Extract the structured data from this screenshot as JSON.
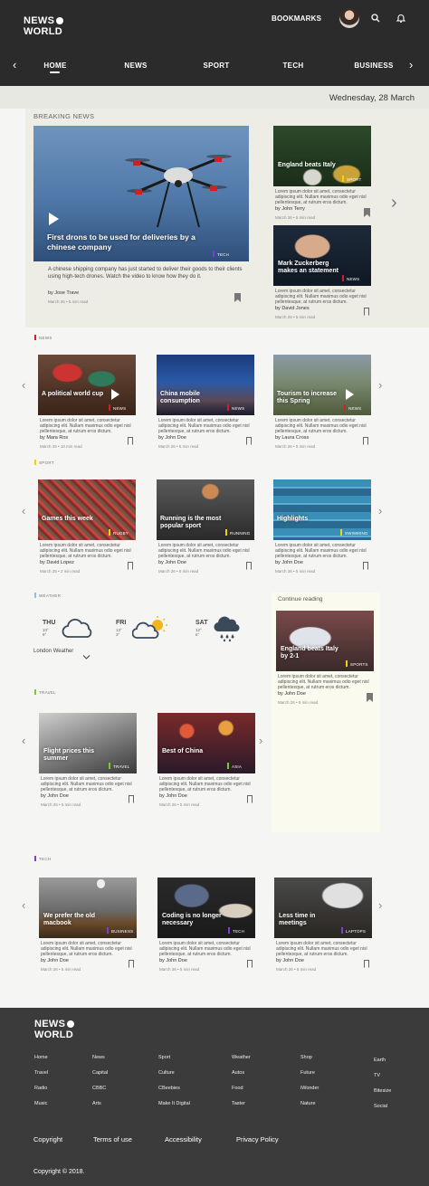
{
  "header": {
    "logo_line1": "NEWS",
    "logo_line2": "WORLD",
    "bookmarks_label": "BOOKMARKS",
    "nav": [
      "HOME",
      "NEWS",
      "SPORT",
      "TECH",
      "BUSINESS"
    ],
    "date": "Wednesday, 28 March"
  },
  "breaking": {
    "section_title": "BREAKING NEWS",
    "main": {
      "title": "First drons to be used for deliveries by a chinese company",
      "tag": "TECH",
      "tag_color": "#7b3fd6",
      "excerpt": "A chinese shipping company has just started to deliver their goods to their clients using high-tech drones. Watch the video to know how they do it.",
      "author": "by Jose Trave",
      "meta": "March 26  •  5 min read"
    },
    "side": [
      {
        "title": "England beats Italy",
        "tag": "SPORT",
        "tag_color": "#f5d200",
        "excerpt": "Lorem ipsum dolor sit amet, consectetur adipiscing elit. Nullam maximus odio eget nisl pellentesque, at rutrum eros dictum.",
        "author": "by John Terry",
        "meta": "March 26  •  5 min read"
      },
      {
        "title": "Mark Zuckerberg makes an statement",
        "tag": "NEWS",
        "tag_color": "#d11f2a",
        "excerpt": "Lorem ipsum dolor sit amet, consectetur adipiscing elit. Nullam maximus odio eget nisl pellentesque, at rutrum eros dictum.",
        "author": "by David Jones",
        "meta": "March 26  •  5 min read"
      }
    ]
  },
  "excerpt": "Lorem ipsum dolor sit amet, consectetur adipiscing elit. Nullam maximus odio eget nisl pellentesque, at rutrum eros dictum.",
  "news": {
    "label": "NEWS",
    "color": "#d11f2a",
    "cards": [
      {
        "title": "A political world cup",
        "tag": "NEWS",
        "author": "by Mara Ros",
        "meta": "March 26  •  10 min read"
      },
      {
        "title": "China mobile consumption",
        "tag": "NEWS",
        "author": "by John Doe",
        "meta": "March 26  •  5 min read"
      },
      {
        "title": "Tourism to increase this Spring",
        "tag": "NEWS",
        "author": "by Laura Cross",
        "meta": "March 26  •  5 min read"
      }
    ]
  },
  "sport": {
    "label": "SPORT",
    "color": "#f5d200",
    "cards": [
      {
        "title": "Games this week",
        "tag": "RUGBY",
        "author": "by David Lopez",
        "meta": "March 25  •  2 min read"
      },
      {
        "title": "Running is the most popular sport",
        "tag": "RUNNING",
        "author": "by John Doe",
        "meta": "March 26  •  5 min read"
      },
      {
        "title": "Highlights",
        "tag": "SWIMMING",
        "author": "by John Doe",
        "meta": "March 26  •  5 min read"
      }
    ]
  },
  "weather": {
    "label": "WEATHER",
    "color": "#7fc8e6",
    "days": [
      {
        "day": "THU",
        "hi": "10°",
        "lo": "9°"
      },
      {
        "day": "FRI",
        "hi": "13°",
        "lo": "3°"
      },
      {
        "day": "SAT",
        "hi": "12°",
        "lo": "6°"
      }
    ],
    "location": "London Weather"
  },
  "continue": {
    "label": "Continue reading",
    "title": "England beats Italy by 2-1",
    "tag": "SPORTS",
    "author": "by John Doe",
    "meta": "March 26  •  5 min read"
  },
  "travel": {
    "label": "TRAVEL",
    "color": "#7dc832",
    "cards": [
      {
        "title": "Flight prices this summer",
        "tag": "TRAVEL",
        "author": "by John Doe",
        "meta": "March 26  •  5 min read"
      },
      {
        "title": "Best of China",
        "tag": "ASIA",
        "author": "by John Doe",
        "meta": "March 26  •  5 min read"
      }
    ]
  },
  "tech": {
    "label": "TECH",
    "color": "#7b3fd6",
    "cards": [
      {
        "title": "We prefer the old macbook",
        "tag": "BUSINESS",
        "author": "by John Doe",
        "meta": "March 26  •  5 min read"
      },
      {
        "title": "Coding is no longer necessary",
        "tag": "TECH",
        "author": "by John Doe",
        "meta": "March 26  •  5 min read"
      },
      {
        "title": "Less time in meetings",
        "tag": "LAPTOPS",
        "author": "by John Doe",
        "meta": "March 26  •  5 min read"
      }
    ]
  },
  "footer": {
    "logo_line1": "NEWS",
    "logo_line2": "WORLD",
    "columns": [
      [
        "Home",
        "Travel",
        "Radio",
        "Music"
      ],
      [
        "News",
        "Capital",
        "CBBC",
        "Arts"
      ],
      [
        "Sport",
        "Culture",
        "CBeebies",
        "Make It Digital"
      ],
      [
        "Weather",
        "Autos",
        "Food",
        "Taster"
      ],
      [
        "Shop",
        "Future",
        "iWonder",
        "Nature"
      ],
      [
        "Earth",
        "TV",
        "Bitesize",
        "Social"
      ]
    ],
    "bottom_links": [
      "Copyright",
      "Terms of use",
      "Accessibility",
      "Privacy Policy"
    ],
    "copyright": "Copyright © 2018."
  }
}
